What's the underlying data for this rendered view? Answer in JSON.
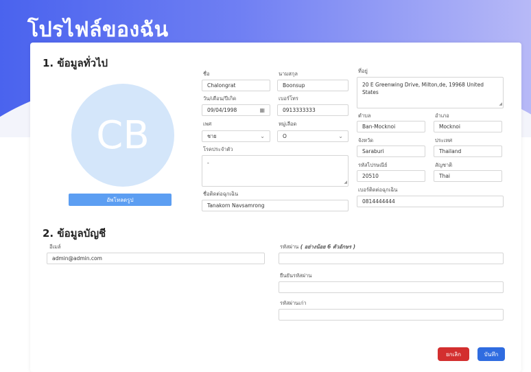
{
  "page": {
    "title": "โปรไฟล์ของฉัน"
  },
  "general": {
    "section_title": "1. ข้อมูลทั่วไป",
    "avatar_initials": "CB",
    "upload_label": "อัพโหลดรูป",
    "first_name": {
      "label": "ชื่อ",
      "value": "Chalongrat"
    },
    "last_name": {
      "label": "นามสกุล",
      "value": "Boonsup"
    },
    "birthdate": {
      "label": "วัน/เดือน/ปีเกิด",
      "value": "09/04/1998"
    },
    "phone": {
      "label": "เบอร์โทร",
      "value": "0913333333"
    },
    "gender": {
      "label": "เพศ",
      "value": "ชาย"
    },
    "blood_group": {
      "label": "หมู่เลือด",
      "value": "O"
    },
    "disease": {
      "label": "โรคประจำตัว",
      "value": "-"
    },
    "emergency_name": {
      "label": "ชื่อติดต่อฉุกเฉิน",
      "value": "Tanakorn Navsamrong"
    },
    "address": {
      "label": "ที่อยู่",
      "value": "20 E Greenwing Drive, Milton,de, 19968  United States"
    },
    "subdistrict": {
      "label": "ตำบล",
      "value": "Ban-Mocknoi"
    },
    "district": {
      "label": "อำเภอ",
      "value": "Mocknoi"
    },
    "province": {
      "label": "จังหวัด",
      "value": "Saraburi"
    },
    "country": {
      "label": "ประเทศ",
      "value": "Thailand"
    },
    "postcode": {
      "label": "รหัสไปรษณีย์",
      "value": "20510"
    },
    "nationality": {
      "label": "สัญชาติ",
      "value": "Thai"
    },
    "emergency_phone": {
      "label": "เบอร์ติดต่อฉุกเฉิน",
      "value": "0814444444"
    }
  },
  "account": {
    "section_title": "2. ข้อมูลบัญชี",
    "email": {
      "label": "อีเมล์",
      "value": "admin@admin.com"
    },
    "password": {
      "label": "รหัสผ่าน",
      "hint": "( อย่างน้อย 6 ตัวอักษร )",
      "value": ""
    },
    "confirm_password": {
      "label": "ยืนยันรหัสผ่าน",
      "value": ""
    },
    "old_password": {
      "label": "รหัสผ่านเก่า",
      "value": ""
    }
  },
  "actions": {
    "cancel": "ยกเลิก",
    "save": "บันทึก"
  },
  "colors": {
    "cancel": "#d32f2f",
    "save": "#2f6ce0",
    "upload": "#5c9ef2",
    "avatar_bg": "#d4e6fa"
  }
}
